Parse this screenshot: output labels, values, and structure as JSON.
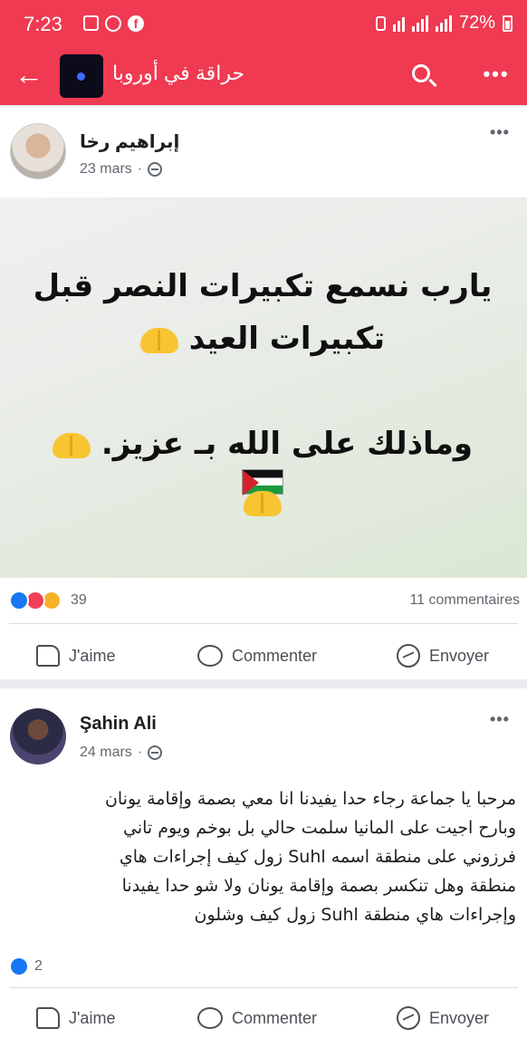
{
  "status_bar": {
    "time": "7:23",
    "battery": "72%"
  },
  "app_bar": {
    "group_name": "حراقة في أوروبا"
  },
  "posts": [
    {
      "author": "إبراهيم رخا",
      "date": "23 mars",
      "poster_lines": [
        "يارب نسمع تكبيرات النصر قبل",
        "تكبيرات العيد",
        "وماذلك على الله بـ عزيز."
      ],
      "reaction_count": "39",
      "comments": "11 commentaires",
      "actions": {
        "like": "J'aime",
        "comment": "Commenter",
        "send": "Envoyer"
      }
    },
    {
      "author": "Şahin Ali",
      "date": "24 mars",
      "text_lines": [
        "مرحبا يا جماعة رجاء حدا يفيدنا انا معي بصمة وإقامة يونان",
        "وبارح اجيت على المانيا سلمت حالي بل بوخم ويوم تاني",
        "فرزوني على منطقة اسمه Suhl زول كيف إجراءات هاي",
        "منطقة وهل تنكسر بصمة وإقامة يونان ولا شو حدا يفيدنا",
        "وإجراءات هاي منطقة Suhl زول كيف وشلون"
      ],
      "reaction_count": "2",
      "actions": {
        "like": "J'aime",
        "comment": "Commenter",
        "send": "Envoyer"
      }
    }
  ],
  "colors": {
    "brand": "#ef3a52",
    "like_blue": "#1877f2"
  }
}
